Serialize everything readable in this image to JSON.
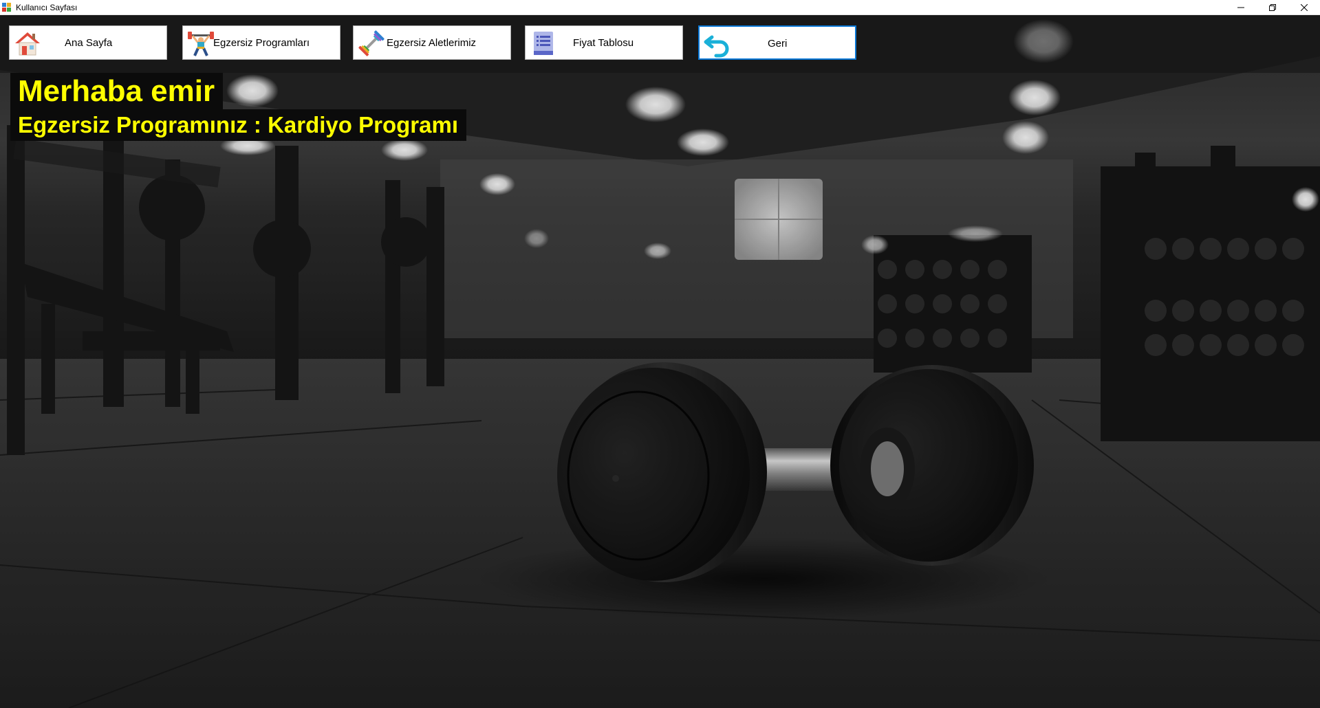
{
  "window": {
    "title": "Kullanıcı Sayfası",
    "controls": [
      "minimize-icon",
      "maximize-icon",
      "close-icon"
    ]
  },
  "nav": {
    "home": {
      "label": "Ana Sayfa",
      "icon": "home-icon"
    },
    "programs": {
      "label": "Egzersiz Programları",
      "icon": "weightlifter-icon"
    },
    "equipment": {
      "label": "Egzersiz Aletlerimiz",
      "icon": "dumbbell-icon"
    },
    "prices": {
      "label": "Fiyat Tablosu",
      "icon": "document-list-icon"
    },
    "back": {
      "label": "Geri",
      "icon": "undo-arrow-icon"
    }
  },
  "greeting": {
    "hello": "Merhaba emir",
    "program": "Egzersiz Programınız : Kardiyo Programı"
  },
  "colors": {
    "label_text": "#ffff00",
    "label_bg": "#0b0b0b",
    "active_border": "#0a78d7",
    "home_roof": "#e04a3a",
    "back_arrow": "#1ab0d8"
  }
}
